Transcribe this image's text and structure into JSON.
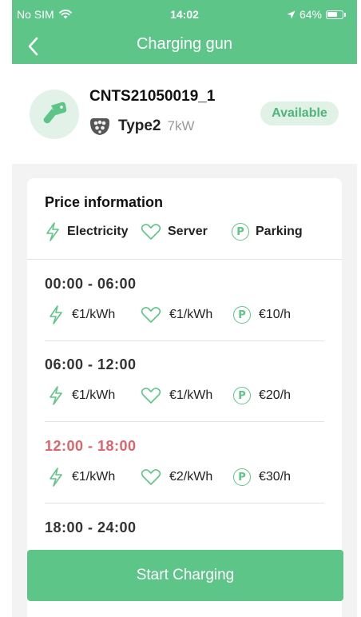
{
  "status_bar": {
    "carrier": "No SIM",
    "time": "14:02",
    "battery": "64%"
  },
  "nav": {
    "title": "Charging gun"
  },
  "charger": {
    "id": "CNTS21050019_1",
    "connector_type": "Type2",
    "power": "7kW",
    "status": "Available"
  },
  "price_info": {
    "title": "Price information",
    "legend": {
      "electricity": "Electricity",
      "server": "Server",
      "parking": "Parking"
    },
    "slots": [
      {
        "time": "00:00 - 06:00",
        "electricity": "€1/kWh",
        "server": "€1/kWh",
        "parking": "€10/h"
      },
      {
        "time": "06:00 - 12:00",
        "electricity": "€1/kWh",
        "server": "€1/kWh",
        "parking": "€20/h"
      },
      {
        "time": "12:00 - 18:00",
        "electricity": "€1/kWh",
        "server": "€2/kWh",
        "parking": "€30/h"
      },
      {
        "time": "18:00 - 24:00",
        "electricity": "",
        "server": "",
        "parking": ""
      }
    ]
  },
  "actions": {
    "start_label": "Start Charging"
  },
  "colors": {
    "brand_green": "#5ec589",
    "active_slot": "#e0636b"
  }
}
